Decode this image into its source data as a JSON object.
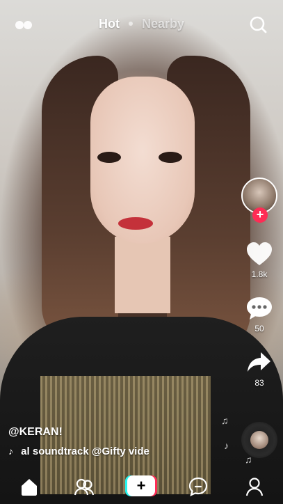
{
  "top": {
    "tabs": [
      {
        "label": "Hot",
        "active": true
      },
      {
        "label": "Nearby",
        "active": false
      }
    ]
  },
  "rail": {
    "likes": "1.8k",
    "comments": "50",
    "shares": "83",
    "follow_label": "+"
  },
  "caption": {
    "username": "@KERAN!",
    "music": "al soundtrack    @Gifty vide"
  },
  "nav": {
    "create_label": "+"
  },
  "colors": {
    "accent_red": "#fe2c55",
    "accent_cyan": "#25f4ee"
  }
}
